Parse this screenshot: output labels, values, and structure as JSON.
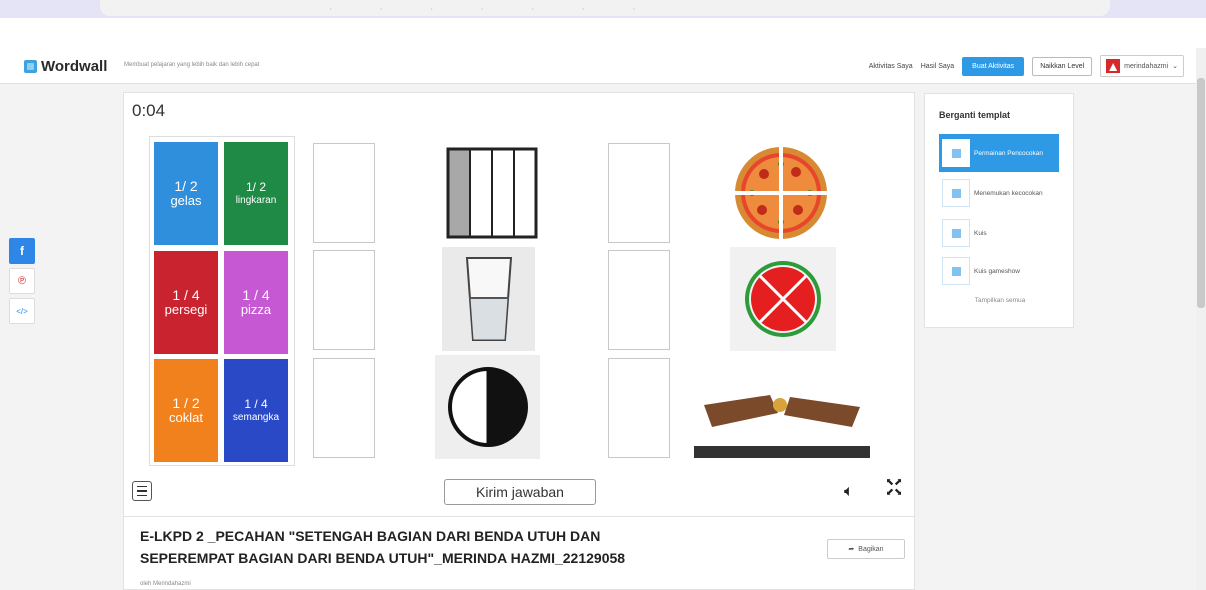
{
  "header": {
    "logo_text": "Wordwall",
    "tagline": "Membuat pelajaran yang lebih baik dan lebih cepat",
    "nav_activities": "Aktivitas Saya",
    "nav_results": "Hasil Saya",
    "create_button": "Buat Aktivitas",
    "upgrade_button": "Naikkan Level",
    "username": "merindahazmi"
  },
  "share": {
    "facebook": "f",
    "pinterest": "℗",
    "embed": "</>"
  },
  "game": {
    "timer": "0:04",
    "tiles": [
      {
        "fraction": "1/ 2",
        "word": "gelas",
        "color": "#2f8fdc"
      },
      {
        "fraction": "1/ 2",
        "word": "lingkaran",
        "color": "#1f8a46"
      },
      {
        "fraction": "1 / 4",
        "word": "persegi",
        "color": "#c8232f"
      },
      {
        "fraction": "1 / 4",
        "word": "pizza",
        "color": "#c658d4"
      },
      {
        "fraction": "1 / 2",
        "word": "coklat",
        "color": "#f0811c"
      },
      {
        "fraction": "1 / 4",
        "word": "semangka",
        "color": "#2a49c6"
      }
    ],
    "submit_label": "Kirim jawaban",
    "sound_icon": "speaker-icon",
    "fullscreen_icon": "fullscreen-icon"
  },
  "activity": {
    "title_line1": "E-LKPD 2 _PECAHAN \"SETENGAH BAGIAN DARI BENDA UTUH DAN",
    "title_line2": "SEPEREMPAT BAGIAN DARI BENDA UTUH\"_MERINDA HAZMI_22129058",
    "share_label": "Bagikan",
    "author": "oleh Merindahazmi"
  },
  "templates": {
    "heading": "Berganti templat",
    "items": [
      {
        "label": "Permainan Pencocokan",
        "active": true
      },
      {
        "label": "Menemukan kecocokan",
        "active": false
      },
      {
        "label": "Kuis",
        "active": false
      },
      {
        "label": "Kuis gameshow",
        "active": false
      }
    ],
    "show_all": "Tampilkan semua"
  }
}
